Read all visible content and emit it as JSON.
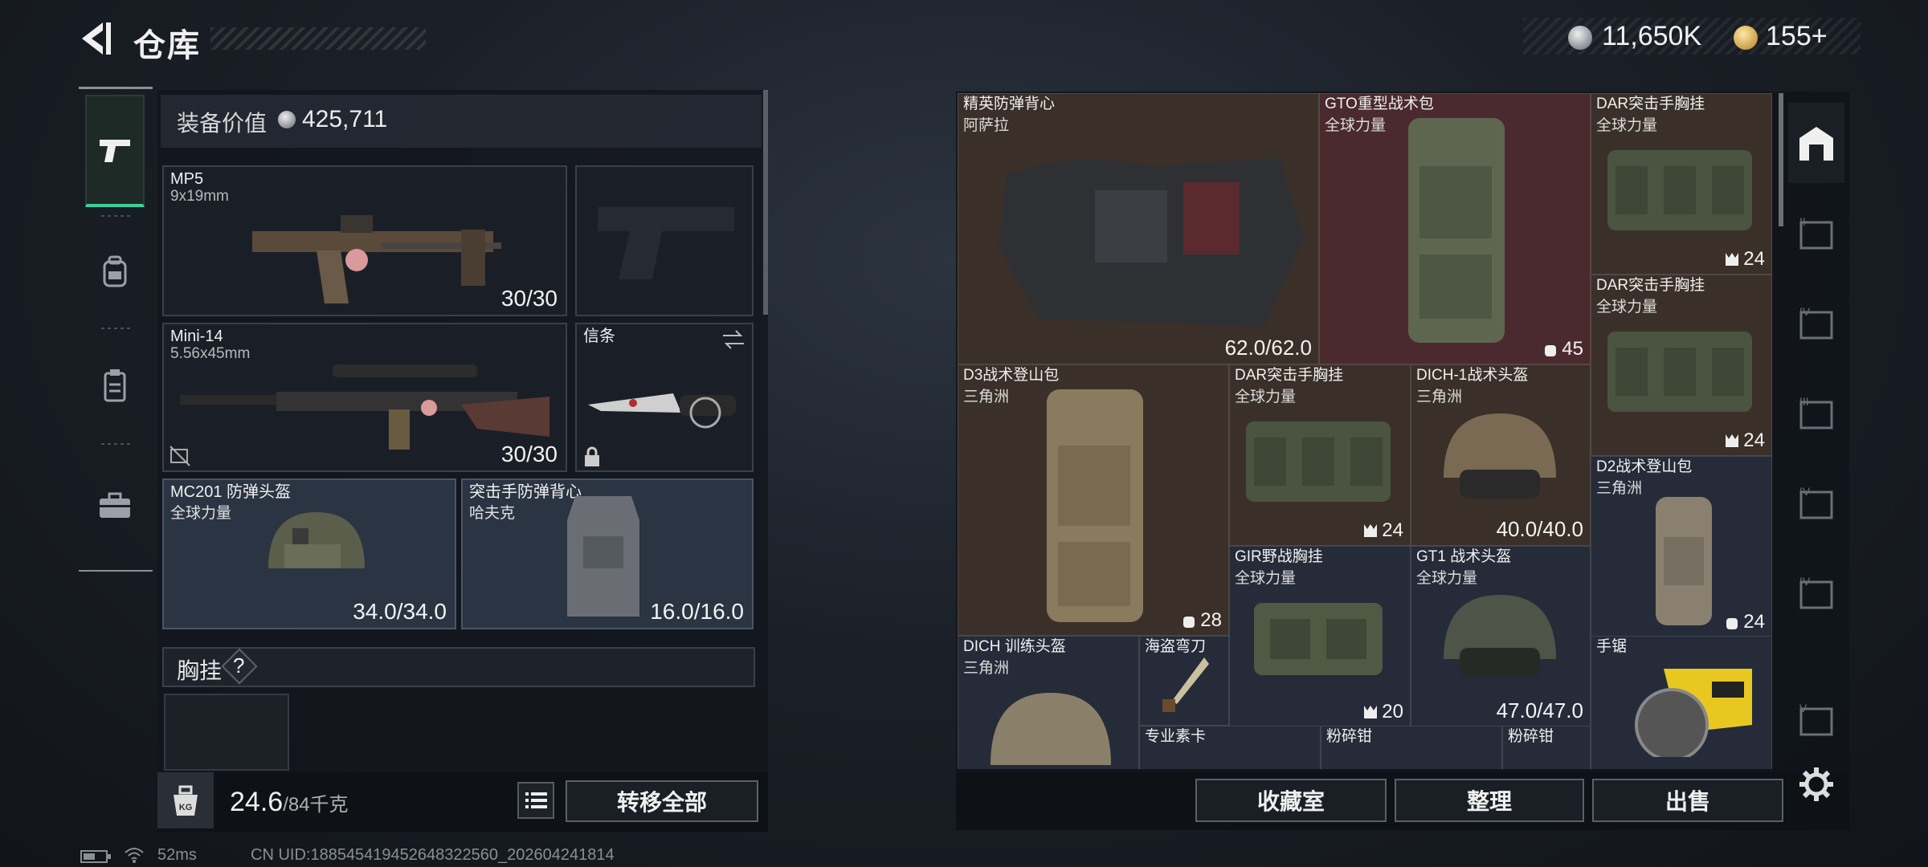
{
  "header": {
    "title": "仓库"
  },
  "currency": {
    "silver": "11,650K",
    "gold": "155+"
  },
  "equipment": {
    "value_label": "装备价值",
    "value": "425,711"
  },
  "slots": {
    "primary": {
      "name": "MP5",
      "caliber": "9x19mm",
      "ammo": "30/30"
    },
    "secondary": {
      "name": "Mini-14",
      "caliber": "5.56x45mm",
      "ammo": "30/30"
    },
    "melee": {
      "name": "信条"
    },
    "helmet": {
      "name": "MC201 防弹头盔",
      "faction": "全球力量",
      "durability": "34.0/34.0"
    },
    "armor": {
      "name": "突击手防弹背心",
      "faction": "哈夫克",
      "durability": "16.0/16.0"
    },
    "chest": {
      "label": "胸挂",
      "help": "?"
    }
  },
  "weight": {
    "current": "24.6",
    "max": "/84千克",
    "kg_icon": "KG"
  },
  "buttons": {
    "transfer_all": "转移全部",
    "collection": "收藏室",
    "sort": "整理",
    "sell": "出售"
  },
  "stash": [
    {
      "name": "精英防弹背心",
      "sub": "阿萨拉",
      "val": "62.0/62.0"
    },
    {
      "name": "GTO重型战术包",
      "sub": "全球力量",
      "badge": "45"
    },
    {
      "name": "DAR突击手胸挂",
      "sub": "全球力量",
      "badge": "24"
    },
    {
      "name": "DAR突击手胸挂",
      "sub": "全球力量",
      "badge": "24"
    },
    {
      "name": "D3战术登山包",
      "sub": "三角洲",
      "badge": "28"
    },
    {
      "name": "DAR突击手胸挂",
      "sub": "全球力量",
      "badge": "24"
    },
    {
      "name": "DICH-1战术头盔",
      "sub": "三角洲",
      "val": "40.0/40.0"
    },
    {
      "name": "D2战术登山包",
      "sub": "三角洲",
      "badge": "24"
    },
    {
      "name": "GIR野战胸挂",
      "sub": "全球力量",
      "badge": "20"
    },
    {
      "name": "GT1 战术头盔",
      "sub": "全球力量",
      "val": "47.0/47.0"
    },
    {
      "name": "DICH 训练头盔",
      "sub": "三角洲"
    },
    {
      "name": "海盗弯刀"
    },
    {
      "name": "手锯"
    },
    {
      "name": "专业素卡"
    },
    {
      "name": "粉碎钳"
    },
    {
      "name": "粉碎钳"
    }
  ],
  "sidebar_right": [
    "I",
    "II",
    "IV",
    "III",
    "IV",
    "IV",
    "V"
  ],
  "status": {
    "ping": "52ms",
    "uid": "CN UID:1885454194526483225​60_202604241814"
  },
  "colors": {
    "accent": "#3ad29b",
    "brown_cell": "#3a3029",
    "red_cell": "#4a2a2e"
  }
}
